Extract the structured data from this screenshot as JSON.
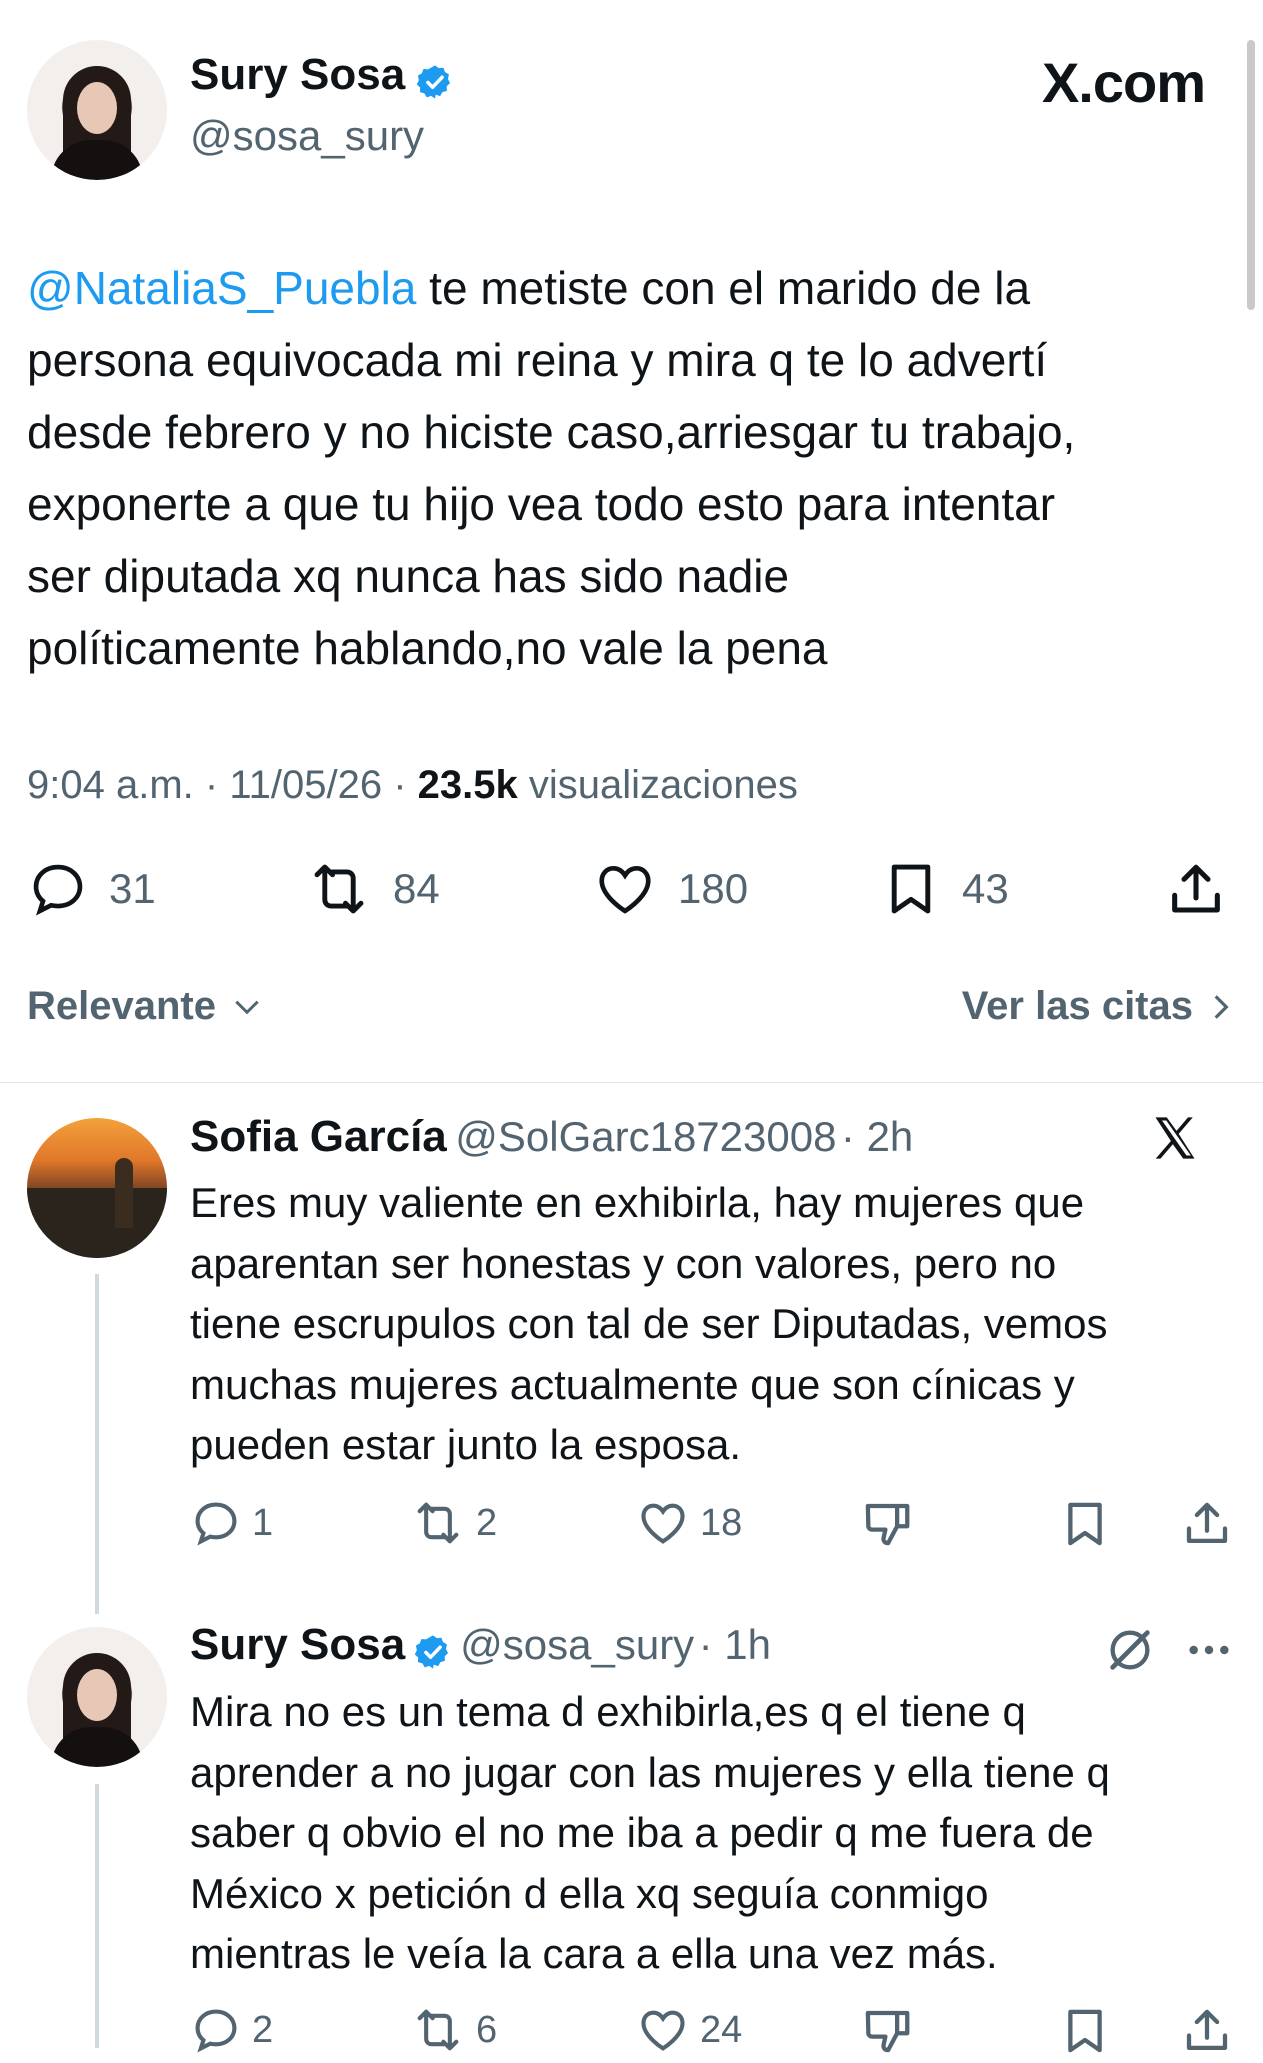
{
  "site_logo": "X.com",
  "tweet": {
    "author_name": "Sury Sosa",
    "author_handle": "@sosa_sury",
    "mention": "@NataliaS_Puebla",
    "lines": [
      " te metiste con el marido de la",
      "persona equivocada mi reina y mira q te lo advertí",
      "desde febrero y no hiciste caso,arriesgar tu trabajo,",
      "exponerte a que tu hijo vea todo esto para intentar",
      "ser diputada xq nunca has sido nadie",
      "políticamente hablando,no vale la pena"
    ],
    "time": "9:04 a.m.",
    "date": "11/05/26",
    "views_count": "23.5k",
    "views_label": "visualizaciones",
    "stats": {
      "replies": "31",
      "reposts": "84",
      "likes": "180",
      "bookmarks": "43"
    }
  },
  "sort": {
    "label": "Relevante",
    "quotes_link": "Ver las citas"
  },
  "replies": [
    {
      "name": "Sofia García",
      "handle": "@SolGarc18723008",
      "age": "2h",
      "lines": [
        "Eres muy valiente en exhibirla, hay mujeres que",
        "aparentan ser honestas y con valores, pero no",
        "tiene escrupulos con tal de ser Diputadas, vemos",
        "muchas mujeres actualmente que son cínicas y",
        "pueden estar junto la esposa."
      ],
      "stats": {
        "replies": "1",
        "reposts": "2",
        "likes": "18"
      }
    },
    {
      "name": "Sury Sosa",
      "handle": "@sosa_sury",
      "age": "1h",
      "lines": [
        "Mira no es un tema d exhibirla,es q el tiene q",
        "aprender a no jugar con las mujeres y ella tiene q",
        "saber q obvio el no me iba a pedir q me fuera de",
        "México x petición d ella  xq seguía conmigo",
        "mientras le veía la cara a ella una vez más."
      ],
      "stats": {
        "replies": "2",
        "reposts": "6",
        "likes": "24"
      }
    }
  ],
  "colors": {
    "accent": "#1d9bf0",
    "text": "#0f1419",
    "muted": "#536471"
  }
}
